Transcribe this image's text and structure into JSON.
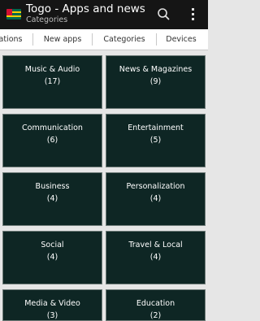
{
  "app": {
    "title": "Togo - Apps and news",
    "subtitle": "Categories",
    "flag_icon": "togo-flag-icon",
    "search_icon": "search-icon",
    "overflow_icon": "overflow-menu-icon"
  },
  "tabs": [
    {
      "label": "ations"
    },
    {
      "label": "New apps"
    },
    {
      "label": "Categories"
    },
    {
      "label": "Devices"
    }
  ],
  "categories": [
    {
      "name": "Music & Audio",
      "count": "(17)"
    },
    {
      "name": "News & Magazines",
      "count": "(9)"
    },
    {
      "name": "Communication",
      "count": "(6)"
    },
    {
      "name": "Entertainment",
      "count": "(5)"
    },
    {
      "name": "Business",
      "count": "(4)"
    },
    {
      "name": "Personalization",
      "count": "(4)"
    },
    {
      "name": "Social",
      "count": "(4)"
    },
    {
      "name": "Travel & Local",
      "count": "(4)"
    },
    {
      "name": "Media & Video",
      "count": "(3)"
    },
    {
      "name": "Education",
      "count": "(2)"
    }
  ],
  "colors": {
    "appbar": "#151515",
    "tile_background": "#0e2624",
    "tile_border": "#6e7b78",
    "page_background": "#e6e6e6"
  }
}
